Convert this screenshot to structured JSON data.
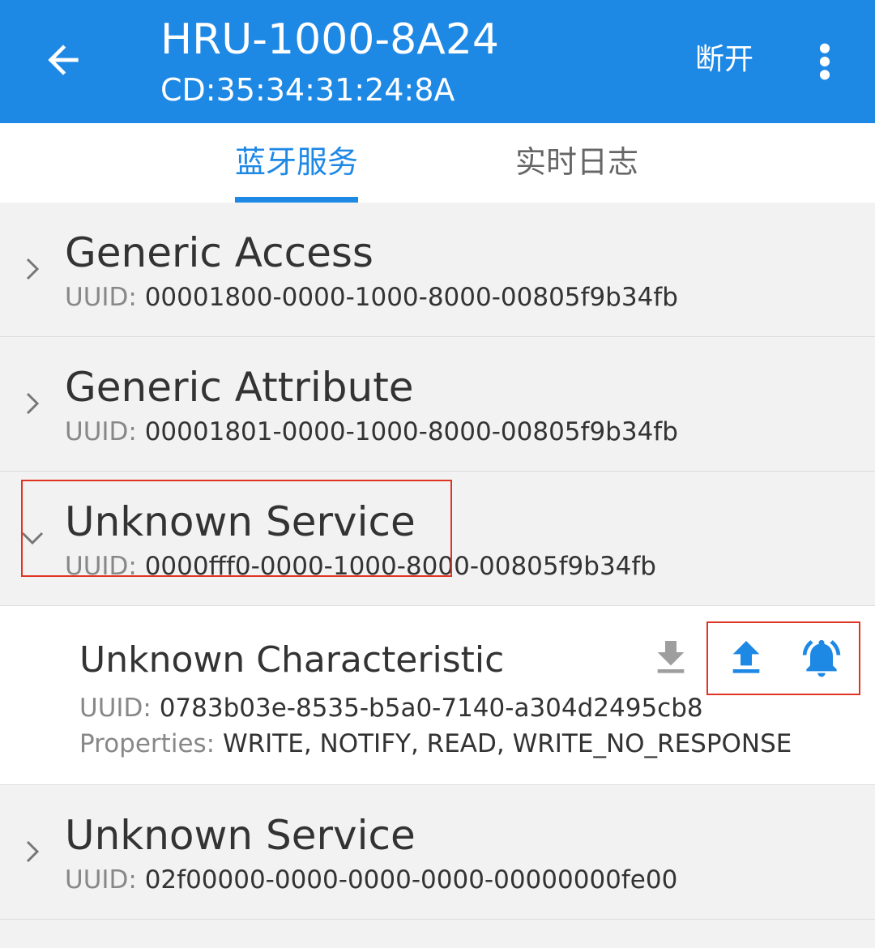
{
  "appbar": {
    "title": "HRU-1000-8A24",
    "subtitle": "CD:35:34:31:24:8A",
    "disconnect_label": "断开"
  },
  "tabs": [
    {
      "label": "蓝牙服务",
      "active": true
    },
    {
      "label": "实时日志",
      "active": false
    }
  ],
  "uuid_label": "UUID:",
  "properties_label": "Properties:",
  "services": [
    {
      "name": "Generic Access",
      "uuid": "00001800-0000-1000-8000-00805f9b34fb",
      "expanded": false
    },
    {
      "name": "Generic Attribute",
      "uuid": "00001801-0000-1000-8000-00805f9b34fb",
      "expanded": false
    },
    {
      "name": "Unknown Service",
      "uuid": "0000fff0-0000-1000-8000-00805f9b34fb",
      "expanded": true
    },
    {
      "name": "Unknown Service",
      "uuid": "02f00000-0000-0000-0000-00000000fe00",
      "expanded": false
    }
  ],
  "characteristic": {
    "name": "Unknown Characteristic",
    "uuid": "0783b03e-8535-b5a0-7140-a304d2495cb8",
    "properties": "WRITE, NOTIFY, READ, WRITE_NO_RESPONSE",
    "actions": [
      "read-icon",
      "write-icon",
      "notify-icon"
    ]
  },
  "colors": {
    "accent": "#1e88e5",
    "highlight": "#e03423",
    "disabled_icon": "#9e9e9e"
  }
}
